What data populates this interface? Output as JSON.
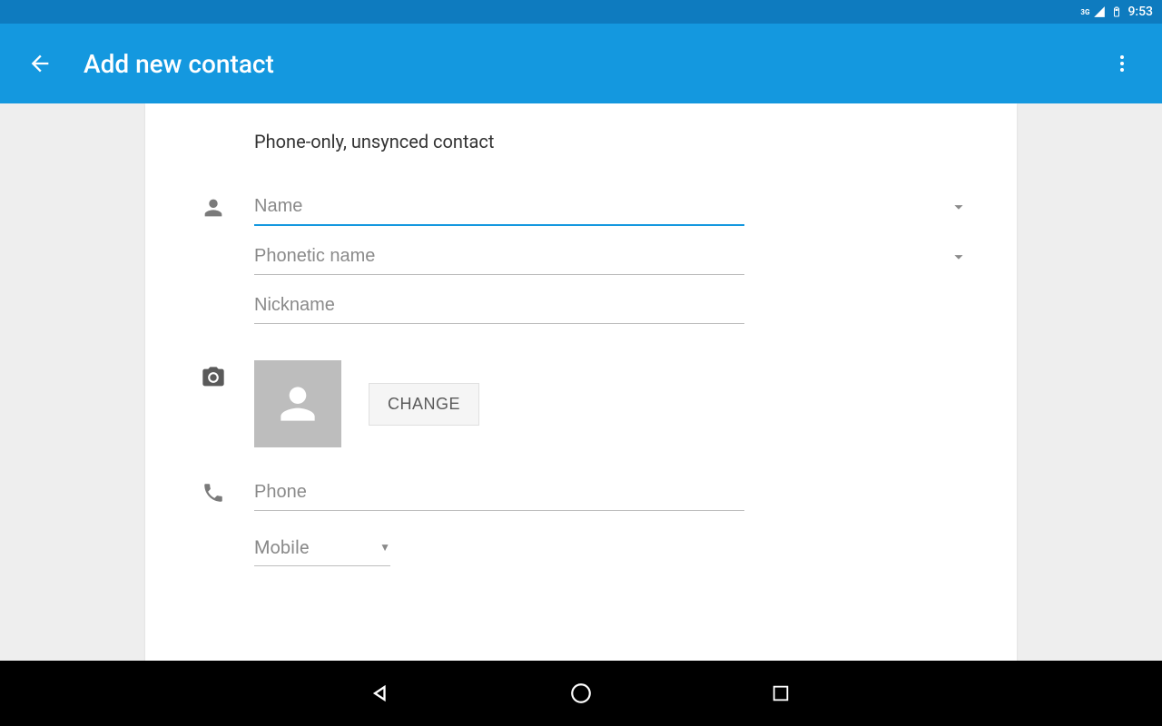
{
  "status_bar": {
    "network": "3G",
    "time": "9:53"
  },
  "app_bar": {
    "title": "Add new contact"
  },
  "form": {
    "subtitle": "Phone-only, unsynced contact",
    "name": {
      "placeholder": "Name",
      "value": ""
    },
    "phonetic": {
      "placeholder": "Phonetic name",
      "value": ""
    },
    "nickname": {
      "placeholder": "Nickname",
      "value": ""
    },
    "change_button": "CHANGE",
    "phone": {
      "placeholder": "Phone",
      "value": ""
    },
    "phone_type": {
      "selected": "Mobile"
    }
  }
}
